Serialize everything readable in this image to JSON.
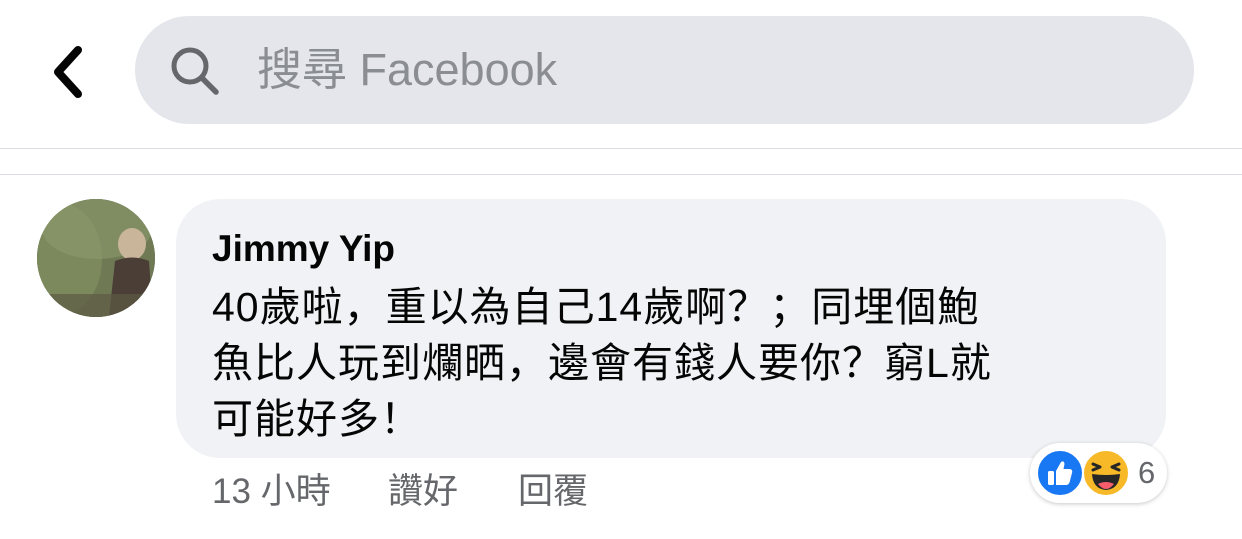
{
  "header": {
    "search_placeholder": "搜尋 Facebook"
  },
  "comment": {
    "author": "Jimmy Yip",
    "lines": [
      "40歲啦，重以為自己14歲啊？；同埋個鮑",
      "魚比人玩到爛晒，邊會有錢人要你？窮L就",
      "可能好多！"
    ],
    "time": "13 小時",
    "like_label": "讚好",
    "reply_label": "回覆",
    "reaction_count": "6",
    "reaction_icons": [
      "like-icon",
      "haha-icon"
    ]
  },
  "colors": {
    "search_bg": "#e4e6eb",
    "bubble_bg": "#f0f2f5",
    "secondary_text": "#65676b",
    "like_blue": "#1877f2",
    "haha_yellow": "#f7b928"
  }
}
